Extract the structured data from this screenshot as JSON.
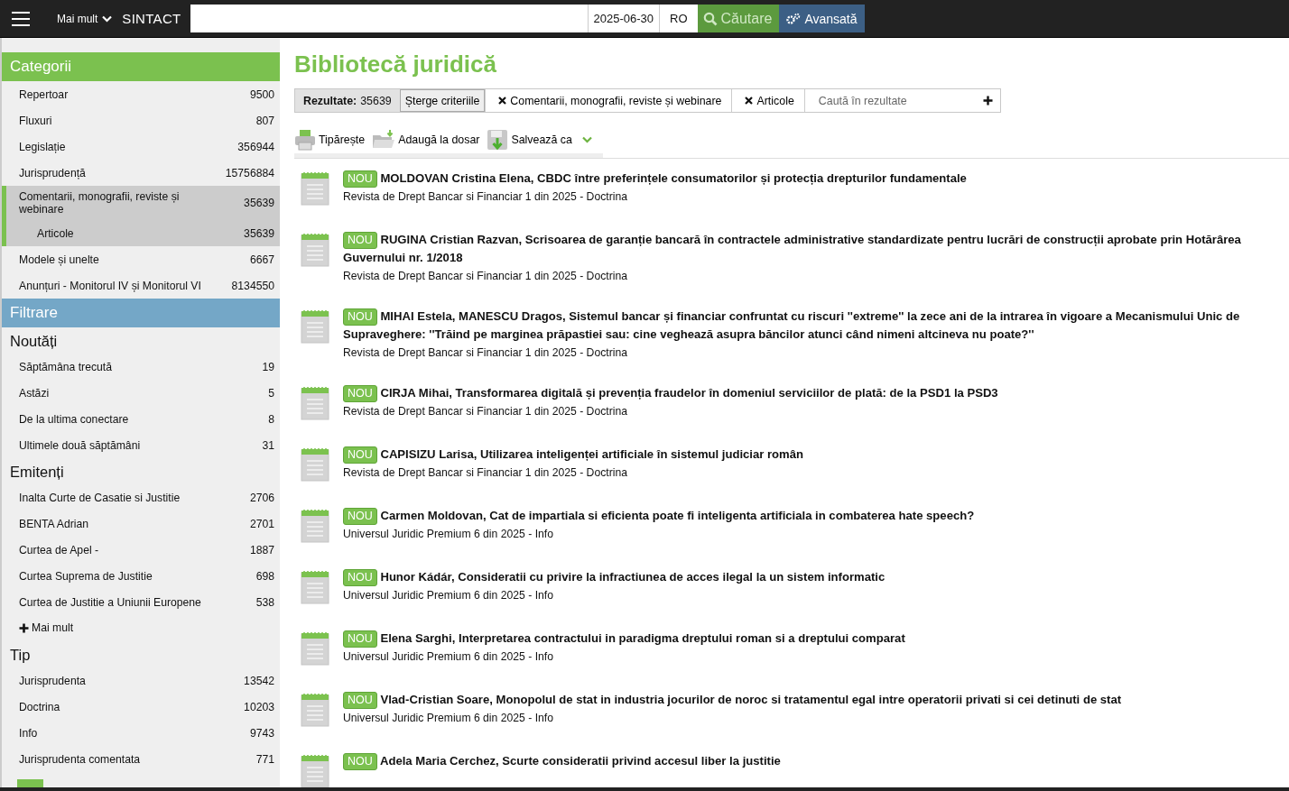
{
  "topbar": {
    "more_label": "Mai mult",
    "brand": "SINTACT",
    "date": "2025-06-30",
    "language": "RO",
    "search_button": "Căutare",
    "advanced_button": "Avansată"
  },
  "sidebar": {
    "categories": {
      "title": "Categorii",
      "items": [
        {
          "label": "Repertoar",
          "count": "9500",
          "selected": false
        },
        {
          "label": "Fluxuri",
          "count": "807",
          "selected": false
        },
        {
          "label": "Legislație",
          "count": "356944",
          "selected": false
        },
        {
          "label": "Jurisprudență",
          "count": "15756884",
          "selected": false
        },
        {
          "label": "Comentarii, monografii, reviste și webinare",
          "count": "35639",
          "selected": true,
          "children": [
            {
              "label": "Articole",
              "count": "35639",
              "selected": true
            }
          ]
        },
        {
          "label": "Modele și unelte",
          "count": "6667",
          "selected": false
        },
        {
          "label": "Anunțuri - Monitorul IV și Monitorul VI",
          "count": "8134550",
          "selected": false
        }
      ]
    },
    "filters": {
      "title": "Filtrare",
      "groups": [
        {
          "title": "Noutăți",
          "items": [
            {
              "label": "Săptămâna trecută",
              "count": "19"
            },
            {
              "label": "Astăzi",
              "count": "5"
            },
            {
              "label": "De la ultima conectare",
              "count": "8"
            },
            {
              "label": "Ultimele două săptămâni",
              "count": "31"
            }
          ]
        },
        {
          "title": "Emitenți",
          "items": [
            {
              "label": "Inalta Curte de Casatie si Justitie",
              "count": "2706"
            },
            {
              "label": "BENTA Adrian",
              "count": "2701"
            },
            {
              "label": "Curtea de Apel -",
              "count": "1887"
            },
            {
              "label": "Curtea Suprema de Justitie",
              "count": "698"
            },
            {
              "label": "Curtea de Justitie a Uniunii Europene",
              "count": "538"
            }
          ],
          "more": "Mai mult"
        },
        {
          "title": "Tip",
          "items": [
            {
              "label": "Jurisprudenta",
              "count": "13542"
            },
            {
              "label": "Doctrina",
              "count": "10203"
            },
            {
              "label": "Info",
              "count": "9743"
            },
            {
              "label": "Jurisprudenta comentata",
              "count": "771"
            }
          ]
        }
      ]
    }
  },
  "page_title": "Bibliotecă juridică",
  "criteria": {
    "results_label": "Rezultate:",
    "results_count": "35639",
    "clear": "Șterge criteriile",
    "chips": [
      "Comentarii, monografii, reviste și webinare",
      "Articole"
    ],
    "search_placeholder": "Caută în rezultate"
  },
  "actions": [
    {
      "kind": "print",
      "label": "Tipărește"
    },
    {
      "kind": "folder",
      "label": "Adaugă la dosar"
    },
    {
      "kind": "save",
      "label": "Salvează ca"
    }
  ],
  "results": [
    {
      "new": true,
      "badge": "NOU",
      "title": "MOLDOVAN Cristina Elena, CBDC între preferințele consumatorilor și protecția drepturilor fundamentale",
      "source": "Revista de Drept Bancar si Financiar 1 din 2025 - Doctrina"
    },
    {
      "new": true,
      "badge": "NOU",
      "title": "RUGINA Cristian Razvan, Scrisoarea de garanție bancară în contractele administrative standardizate pentru lucrări de construcții aprobate prin Hotărârea Guvernului nr. 1/2018",
      "source": "Revista de Drept Bancar si Financiar 1 din 2025 - Doctrina"
    },
    {
      "new": true,
      "badge": "NOU",
      "title": "MIHAI Estela, MANESCU Dragos, Sistemul bancar și financiar confruntat cu riscuri ''extreme'' la zece ani de la intrarea în vigoare a Mecanismului Unic de Supraveghere: ''Trăind pe marginea prăpastiei sau: cine veghează asupra băncilor atunci când nimeni altcineva nu poate?''",
      "source": "Revista de Drept Bancar si Financiar 1 din 2025 - Doctrina"
    },
    {
      "new": true,
      "badge": "NOU",
      "title": "CIRJA Mihai, Transformarea digitală și prevenția fraudelor în domeniul serviciilor de plată: de la PSD1 la PSD3",
      "source": "Revista de Drept Bancar si Financiar 1 din 2025 - Doctrina"
    },
    {
      "new": true,
      "badge": "NOU",
      "title": "CAPISIZU Larisa, Utilizarea inteligenței artificiale în sistemul judiciar român",
      "source": "Revista de Drept Bancar si Financiar 1 din 2025 - Doctrina"
    },
    {
      "new": true,
      "badge": "NOU",
      "title": "Carmen Moldovan, Cat de impartiala si eficienta poate fi inteligenta artificiala in combaterea hate speech?",
      "source": "Universul Juridic Premium 6 din 2025 - Info"
    },
    {
      "new": true,
      "badge": "NOU",
      "title": "Hunor Kádár, Consideratii cu privire la infractiunea de acces ilegal la un sistem informatic",
      "source": "Universul Juridic Premium 6 din 2025 - Info"
    },
    {
      "new": true,
      "badge": "NOU",
      "title": "Elena Sarghi, Interpretarea contractului in paradigma dreptului roman si a dreptului comparat",
      "source": "Universul Juridic Premium 6 din 2025 - Info"
    },
    {
      "new": true,
      "badge": "NOU",
      "title": "Vlad-Cristian Soare, Monopolul de stat in industria jocurilor de noroc si tratamentul egal intre operatorii privati si cei detinuti de stat",
      "source": "Universul Juridic Premium 6 din 2025 - Info"
    },
    {
      "new": true,
      "badge": "NOU",
      "title": "Adela Maria Cerchez, Scurte consideratii privind accesul liber la justitie"
    }
  ]
}
